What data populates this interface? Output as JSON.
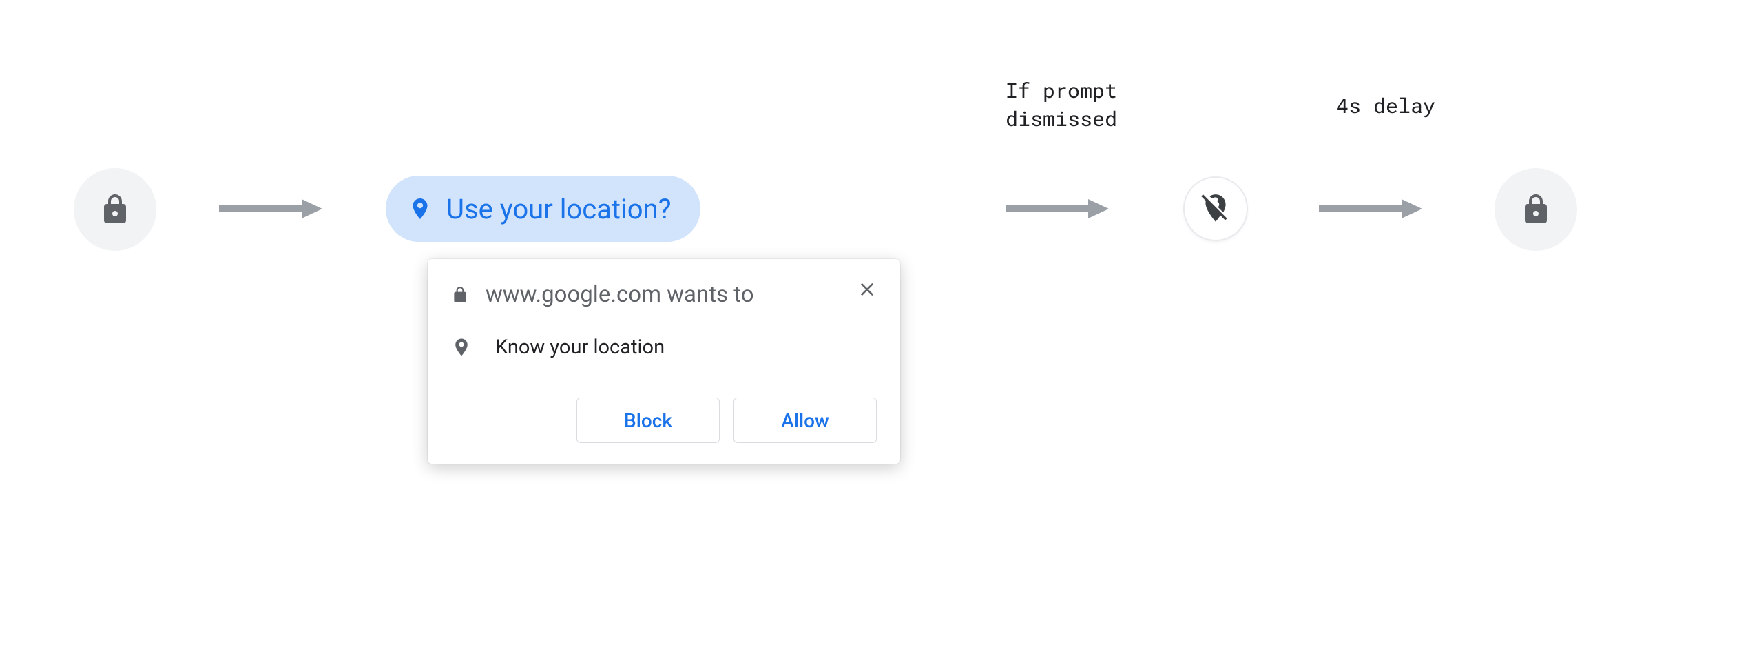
{
  "chip": {
    "label": "Use your location?"
  },
  "permission": {
    "origin_wants_to": "www.google.com wants to",
    "know_location": "Know your location",
    "block": "Block",
    "allow": "Allow"
  },
  "captions": {
    "dismissed": "If prompt\ndismissed",
    "delay": "4s delay"
  },
  "colors": {
    "blue": "#1a73e8",
    "chip_bg": "#d2e3fc",
    "gray_icon": "#5f6368",
    "arrow": "#9aa0a6"
  }
}
